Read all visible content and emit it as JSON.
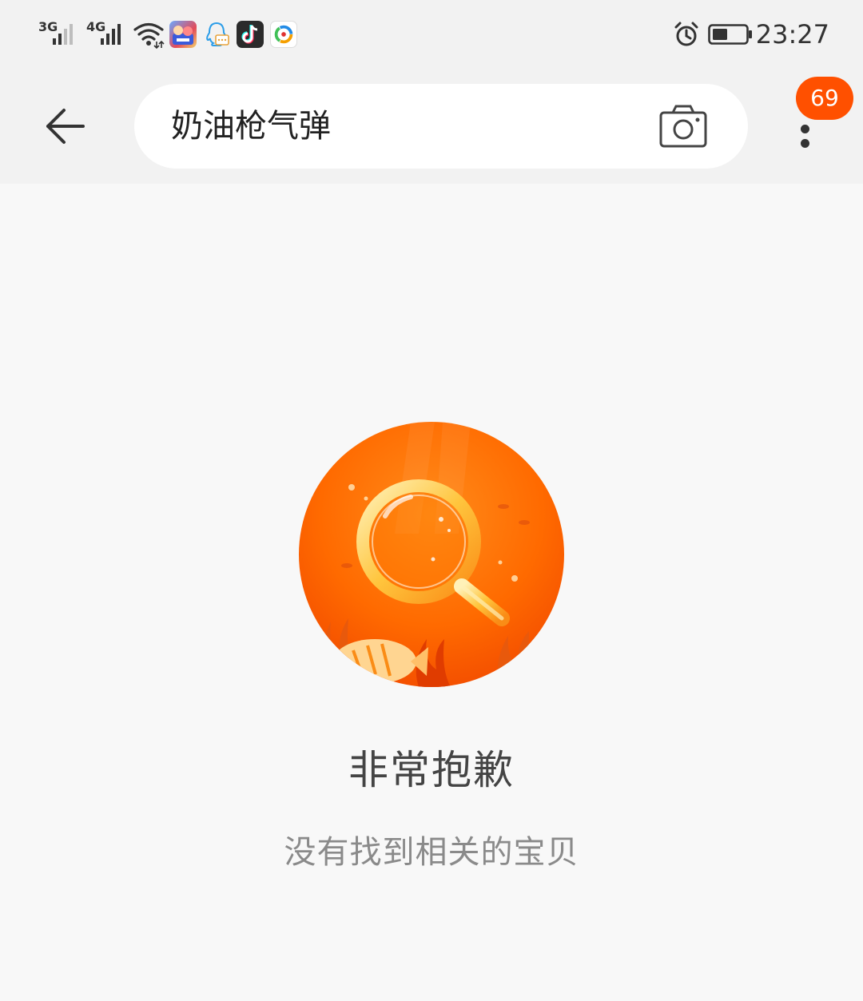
{
  "status_bar": {
    "signal_1_label": "3G",
    "signal_2_label": "4G",
    "time": "23:27",
    "app_icons": [
      "game-icon",
      "qq-icon",
      "tiktok-icon",
      "browser-icon"
    ]
  },
  "search": {
    "query": "奶油枪气弹"
  },
  "header": {
    "badge_count": "69"
  },
  "empty_state": {
    "title": "非常抱歉",
    "subtitle": "没有找到相关的宝贝"
  },
  "colors": {
    "accent": "#ff5000",
    "illustration_orange": "#ff6a00",
    "illustration_gold": "#ffc53d"
  }
}
